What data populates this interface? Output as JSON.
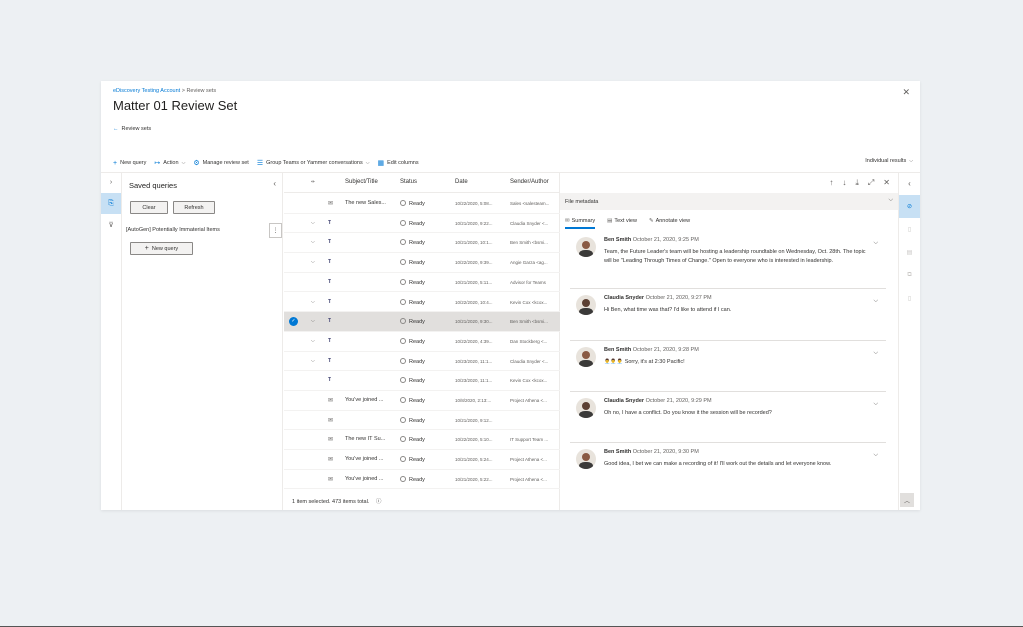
{
  "breadcrumb": {
    "parent": "eDiscovery Testing Account",
    "sep": ">",
    "current": "Review sets"
  },
  "title": "Matter 01 Review Set",
  "back_label": "Review sets",
  "commands": [
    {
      "icon": "+",
      "label": "New query",
      "chev": ""
    },
    {
      "icon": "↦",
      "label": "Action",
      "chev": "⌵"
    },
    {
      "icon": "⚙",
      "label": "Manage review set",
      "chev": ""
    },
    {
      "icon": "☰",
      "label": "Group Teams or Yammer conversations",
      "chev": "⌵"
    },
    {
      "icon": "▦",
      "label": "Edit columns",
      "chev": ""
    }
  ],
  "view_select": "Individual results",
  "saved": {
    "title": "Saved queries",
    "clear": "Clear",
    "refresh": "Refresh",
    "item": "[AutoGen] Potentially Immaterial Items",
    "new_query": "New query"
  },
  "table": {
    "headers": {
      "subject": "Subject/Title",
      "status": "Status",
      "date": "Date",
      "sender": "Sender/Author"
    },
    "rows": [
      {
        "exp": "",
        "type": "✉",
        "teams": false,
        "subject": "The new Sales...",
        "status": "Ready",
        "date": "10/22/2020, 5:08...",
        "sender": "Sales <salesteam..."
      },
      {
        "exp": "⌵",
        "type": "T",
        "teams": true,
        "subject": "",
        "status": "Ready",
        "date": "10/21/2020, 9:22...",
        "sender": "Claudia Snyder <..."
      },
      {
        "exp": "⌵",
        "type": "T",
        "teams": true,
        "subject": "",
        "status": "Ready",
        "date": "10/21/2020, 10:1...",
        "sender": "Ben Smith <bsmi..."
      },
      {
        "exp": "⌵",
        "type": "T",
        "teams": true,
        "subject": "",
        "status": "Ready",
        "date": "10/22/2020, 9:39...",
        "sender": "Angie Garza <ag..."
      },
      {
        "exp": "",
        "type": "T",
        "teams": true,
        "subject": "",
        "status": "Ready",
        "date": "10/21/2020, 5:11...",
        "sender": "Advisor for Teams"
      },
      {
        "exp": "⌵",
        "type": "T",
        "teams": true,
        "subject": "",
        "status": "Ready",
        "date": "10/22/2020, 10:4...",
        "sender": "Kevin Cox <kcox..."
      },
      {
        "exp": "⌵",
        "type": "T",
        "teams": true,
        "subject": "",
        "status": "Ready",
        "date": "10/21/2020, 9:30...",
        "sender": "Ben Smith <bsmi...",
        "selected": true
      },
      {
        "exp": "⌵",
        "type": "T",
        "teams": true,
        "subject": "",
        "status": "Ready",
        "date": "10/22/2020, 4:39...",
        "sender": "Dan Stockberg <..."
      },
      {
        "exp": "⌵",
        "type": "T",
        "teams": true,
        "subject": "",
        "status": "Ready",
        "date": "10/23/2020, 11:1...",
        "sender": "Claudia Snyder <..."
      },
      {
        "exp": "",
        "type": "T",
        "teams": true,
        "subject": "",
        "status": "Ready",
        "date": "10/23/2020, 11:1...",
        "sender": "Kevin Cox <kcox..."
      },
      {
        "exp": "",
        "type": "✉",
        "teams": false,
        "subject": "You've joined ...",
        "status": "Ready",
        "date": "10/8/2020, 2:13:...",
        "sender": "Project Athena <..."
      },
      {
        "exp": "",
        "type": "✉",
        "teams": false,
        "subject": "",
        "status": "Ready",
        "date": "10/21/2020, 9:12...",
        "sender": ""
      },
      {
        "exp": "",
        "type": "✉",
        "teams": false,
        "subject": "The new IT Su...",
        "status": "Ready",
        "date": "10/22/2020, 5:10...",
        "sender": "IT Support Team ..."
      },
      {
        "exp": "",
        "type": "✉",
        "teams": false,
        "subject": "You've joined ...",
        "status": "Ready",
        "date": "10/21/2020, 5:24...",
        "sender": "Project Athena <..."
      },
      {
        "exp": "",
        "type": "✉",
        "teams": false,
        "subject": "You've joined ...",
        "status": "Ready",
        "date": "10/21/2020, 5:22...",
        "sender": "Project Athena <..."
      }
    ],
    "footer": "1 item selected.  473 items total."
  },
  "preview": {
    "meta_label": "File metadata",
    "tabs": [
      {
        "icon": "✉",
        "label": "Summary"
      },
      {
        "icon": "▤",
        "label": "Text view"
      },
      {
        "icon": "✎",
        "label": "Annotate view"
      }
    ],
    "messages": [
      {
        "author": "Ben Smith",
        "time": "October 21, 2020, 9:25 PM",
        "text": "Team, the Future Leader's team will be hosting a leadership roundtable on Wednesday, Oct. 28th.  The topic will be \"Leading Through Times of Change.\"  Open to everyone who is interested in leadership.",
        "avatar_color": "#8a5a44"
      },
      {
        "author": "Claudia Snyder",
        "time": "October 21, 2020, 9:27 PM",
        "text": "Hi Ben, what time was that?  I'd like to attend if I can.",
        "avatar_color": "#5c4033"
      },
      {
        "author": "Ben Smith",
        "time": "October 21, 2020, 9:28 PM",
        "text": "Sorry, it's at 2:30 Pacific!",
        "emoji": "👨‍💼👨‍💼👨‍💼",
        "avatar_color": "#8a5a44"
      },
      {
        "author": "Claudia Snyder",
        "time": "October 21, 2020, 9:29 PM",
        "text": "Oh no, I have a conflict.  Do you know it the session will be recorded?",
        "avatar_color": "#5c4033"
      },
      {
        "author": "Ben Smith",
        "time": "October 21, 2020, 9:30 PM",
        "text": "Good idea, I bet we can make a recording of it!  I'll work out the details and let everyone know.",
        "avatar_color": "#8a5a44"
      }
    ]
  }
}
